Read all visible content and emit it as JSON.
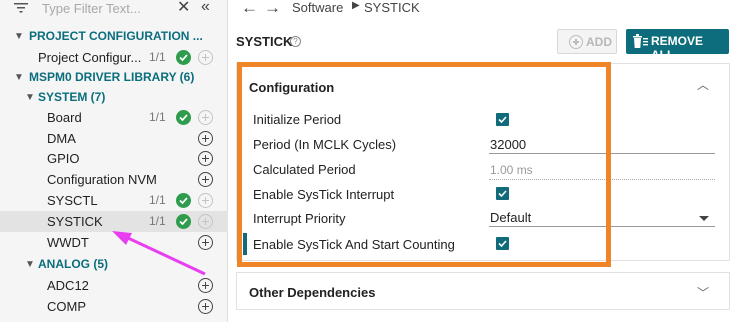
{
  "filter": {
    "placeholder": "Type Filter Text...",
    "clear_icon": "close-icon",
    "collapse_icon": "collapse-all-icon"
  },
  "tree": [
    {
      "kind": "category",
      "label": "PROJECT CONFIGURATION ...",
      "expanded": true
    },
    {
      "kind": "item",
      "label": "Project Configur...",
      "count": "1/1",
      "status": "ok",
      "add": "disabled"
    },
    {
      "kind": "category",
      "label": "MSPM0 DRIVER LIBRARY (6)",
      "expanded": true
    },
    {
      "kind": "category",
      "label": "SYSTEM (7)",
      "expanded": true
    },
    {
      "kind": "item",
      "label": "Board",
      "count": "1/1",
      "status": "ok",
      "add": "disabled"
    },
    {
      "kind": "item",
      "label": "DMA",
      "count": "",
      "status": "",
      "add": "enabled"
    },
    {
      "kind": "item",
      "label": "GPIO",
      "count": "",
      "status": "",
      "add": "enabled"
    },
    {
      "kind": "item",
      "label": "Configuration NVM",
      "count": "",
      "status": "",
      "add": "enabled"
    },
    {
      "kind": "item",
      "label": "SYSCTL",
      "count": "1/1",
      "status": "ok",
      "add": "disabled"
    },
    {
      "kind": "item",
      "label": "SYSTICK",
      "count": "1/1",
      "status": "ok",
      "add": "disabled",
      "selected": true
    },
    {
      "kind": "item",
      "label": "WWDT",
      "count": "",
      "status": "",
      "add": "enabled"
    },
    {
      "kind": "category",
      "label": "ANALOG (5)",
      "expanded": true
    },
    {
      "kind": "item",
      "label": "ADC12",
      "count": "",
      "status": "",
      "add": "enabled"
    },
    {
      "kind": "item",
      "label": "COMP",
      "count": "",
      "status": "",
      "add": "enabled"
    }
  ],
  "breadcrumb": {
    "parent": "Software",
    "current": "SYSTICK"
  },
  "header": {
    "title": "SYSTICK",
    "add_label": "ADD",
    "remove_all_label": "REMOVE ALL"
  },
  "config": {
    "title": "Configuration",
    "rows": [
      {
        "label": "Initialize Period",
        "type": "checkbox",
        "checked": true
      },
      {
        "label": "Period (In MCLK Cycles)",
        "type": "text",
        "value": "32000"
      },
      {
        "label": "Calculated Period",
        "type": "readonly",
        "value": "1.00 ms"
      },
      {
        "label": "Enable SysTick Interrupt",
        "type": "checkbox",
        "checked": true
      },
      {
        "label": "Interrupt Priority",
        "type": "select",
        "value": "Default"
      },
      {
        "label": "Enable SysTick And Start Counting",
        "type": "checkbox",
        "checked": true
      }
    ]
  },
  "other_dependencies": {
    "title": "Other Dependencies"
  },
  "colors": {
    "accent": "#0e6d7d",
    "ok": "#2e9c4c",
    "highlight": "#f08528",
    "annotation_arrow": "#e83ff0"
  }
}
